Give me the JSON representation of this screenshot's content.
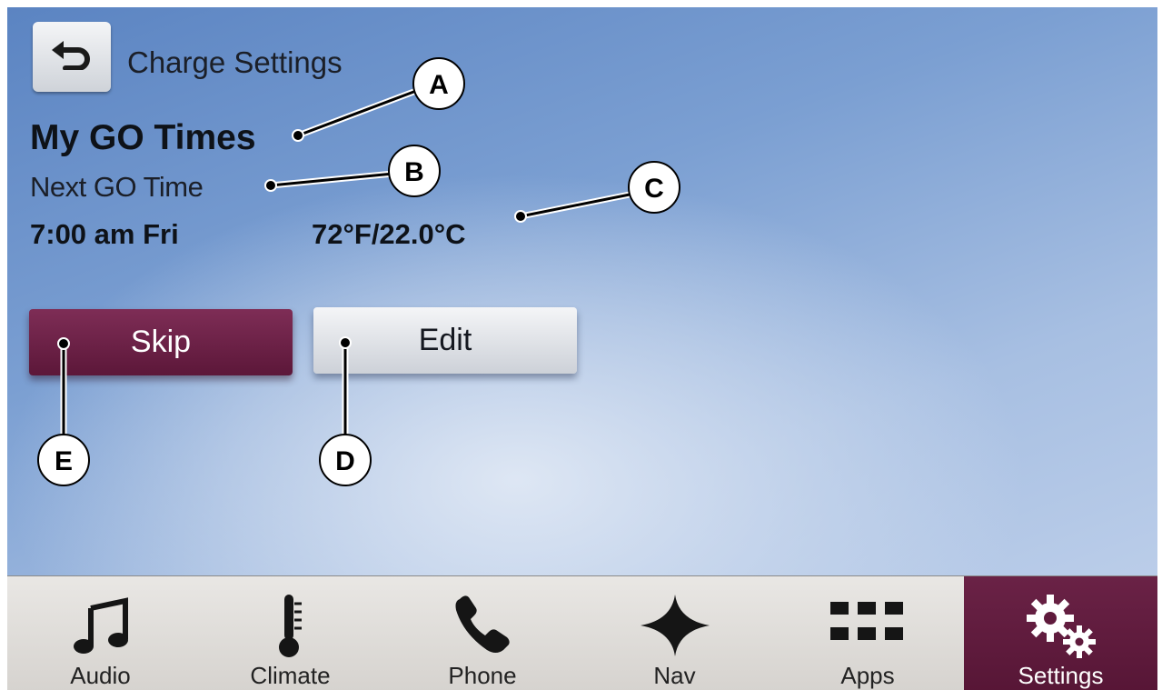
{
  "header": {
    "back_icon": "back-arrow-icon",
    "title": "Charge Settings"
  },
  "go_times": {
    "heading": "My GO Times",
    "next_label": "Next GO Time",
    "time": "7:00 am Fri",
    "temperature": "72°F/22.0°C"
  },
  "actions": {
    "skip_label": "Skip",
    "edit_label": "Edit"
  },
  "callouts": {
    "a": "A",
    "b": "B",
    "c": "C",
    "d": "D",
    "e": "E"
  },
  "nav": [
    {
      "label": "Audio",
      "icon": "music-note-icon"
    },
    {
      "label": "Climate",
      "icon": "thermometer-icon"
    },
    {
      "label": "Phone",
      "icon": "phone-icon"
    },
    {
      "label": "Nav",
      "icon": "compass-star-icon"
    },
    {
      "label": "Apps",
      "icon": "apps-grid-icon"
    },
    {
      "label": "Settings",
      "icon": "gears-icon",
      "active": true
    }
  ],
  "colors": {
    "accent_plum": "#6a2246",
    "background_blue": "#6f94cc",
    "nav_bar": "#e2e0dd"
  }
}
